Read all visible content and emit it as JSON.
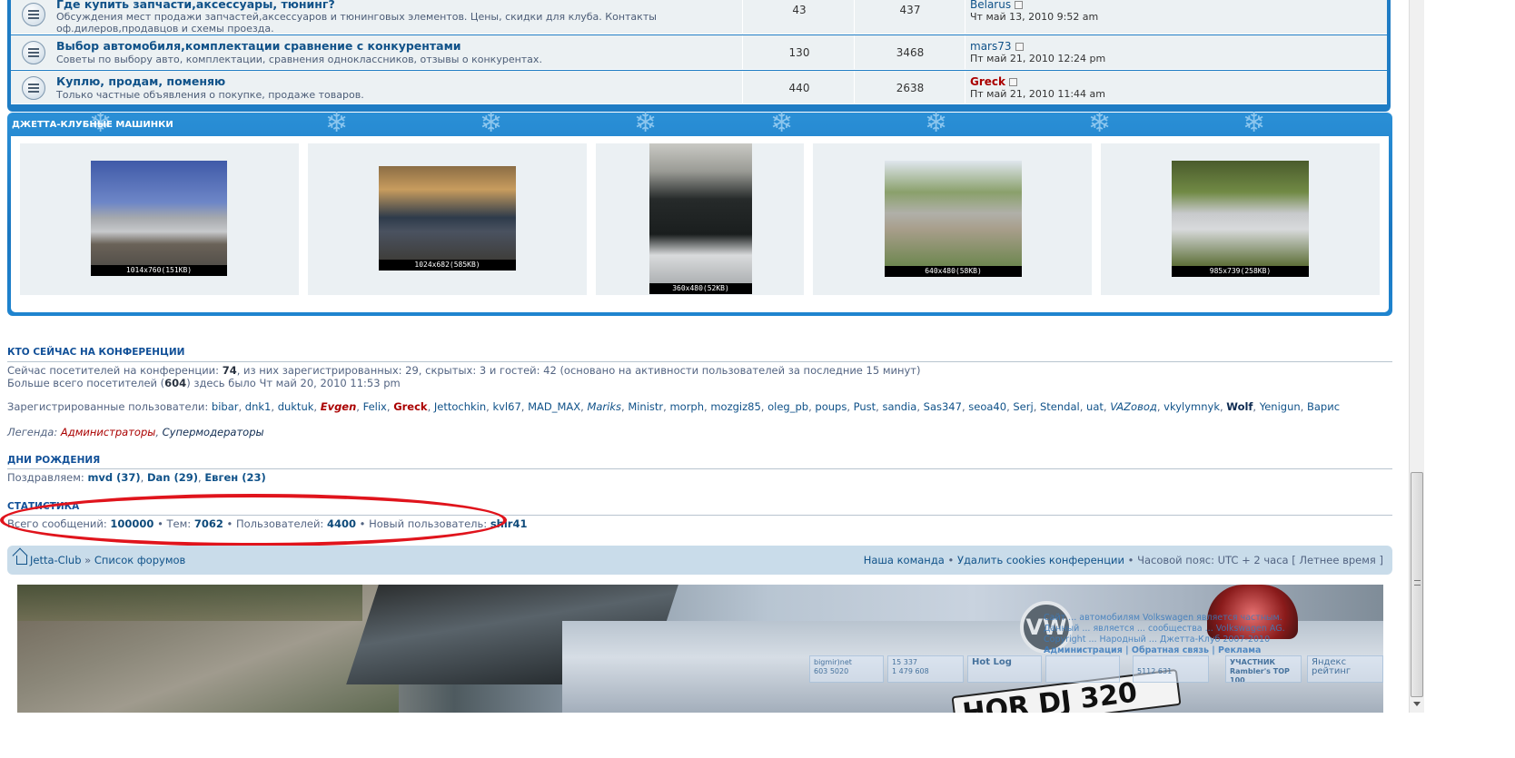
{
  "forums": [
    {
      "title": "Где купить запчасти,аксессуары, тюнинг?",
      "description": "Обсуждения мест продажи запчастей,аксессуаров и тюнинговых элементов. Цены, скидки для клуба. Контакты оф.дилеров,продавцов и схемы проезда.",
      "topics": "43",
      "posts": "437",
      "last_user": "Belarus",
      "last_date": "Чт май 13, 2010 9:52 am"
    },
    {
      "title": "Выбор автомобиля,комплектации сравнение с конкурентами",
      "description": "Советы по выбору авто, комплектации, сравнения одноклассников, отзывы о конкурентах.",
      "topics": "130",
      "posts": "3468",
      "last_user": "mars73",
      "last_date": "Пт май 21, 2010 12:24 pm"
    },
    {
      "title": "Куплю, продам, поменяю",
      "description": "Только частные объявления о покупке, продаже товаров.",
      "topics": "440",
      "posts": "2638",
      "last_user": "Greck",
      "last_date": "Пт май 21, 2010 11:44 am"
    }
  ],
  "gallery": {
    "title": "ДЖЕТТА-КЛУБНЫЕ МАШИНКИ",
    "images": [
      {
        "caption": "1014x760(151KB)"
      },
      {
        "caption": "1024x682(585KB)"
      },
      {
        "caption": "360x480(52KB)"
      },
      {
        "caption": "640x480(58KB)"
      },
      {
        "caption": "985x739(258KB)"
      }
    ]
  },
  "online": {
    "heading": "КТО СЕЙЧАС НА КОНФЕРЕНЦИИ",
    "line1_pre": "Сейчас посетителей на конференции: ",
    "line1_total": "74",
    "line1_post": ", из них зарегистрированных: 29, скрытых: 3 и гостей: 42 (основано на активности пользователей за последние 15 минут)",
    "line2_pre": "Больше всего посетителей (",
    "line2_max": "604",
    "line2_post": ") здесь было Чт май 20, 2010 11:53 pm",
    "registered_label": "Зарегистрированные пользователи: ",
    "legend_label": "Легенда: ",
    "legend_admins": "Администраторы",
    "legend_mods": "Супермодераторы"
  },
  "birthdays": {
    "heading": "ДНИ РОЖДЕНИЯ",
    "label": "Поздравляем: ",
    "people": [
      "mvd (37)",
      "Dan (29)",
      "Евген (23)"
    ]
  },
  "statistics": {
    "heading": "СТАТИСТИКА",
    "posts_label": "Всего сообщений: ",
    "posts": "100000",
    "topics_label": " • Тем: ",
    "topics": "7062",
    "users_label": " • Пользователей: ",
    "users": "4400",
    "newest_label": " • Новый пользователь: ",
    "newest": "shir41"
  },
  "navbar": {
    "home": "Jetta-Club",
    "separator": "»",
    "forum_list": "Список форумов",
    "team": "Наша команда",
    "bullet": "•",
    "delete_cookies": "Удалить cookies конференции",
    "timezone": "Часовой пояс: UTC + 2 часа [ Летнее время ]"
  },
  "footer": {
    "plate_text": "HOR DJ 320",
    "vw_logo": "VW",
    "copy_1": "Сайт ... автомобилям Volkswagen является частным.",
    "copy_2": "Данный ... является ... сообщества ... Volkswagen AG.",
    "copy_3": "Copyright ... Народный ... Джетта-Клуб 2007-2010",
    "copy_4": "Администрация | Обратная связь | Реклама",
    "counters": [
      {
        "name": "bigmir)net",
        "a": "603",
        "b": "5020"
      },
      {
        "name": "15 337",
        "a": "1 479",
        "b": "608"
      },
      {
        "name": "Hot Log",
        "a": "",
        "b": ""
      },
      {
        "name": "",
        "a": "",
        "b": ""
      },
      {
        "name": "",
        "a": "5112",
        "b": "631"
      },
      {
        "name": "УЧАСТНИК Rambler's TOP 100",
        "a": "",
        "b": ""
      },
      {
        "name": "Яндекс рейтинг",
        "a": "",
        "b": ""
      }
    ]
  }
}
